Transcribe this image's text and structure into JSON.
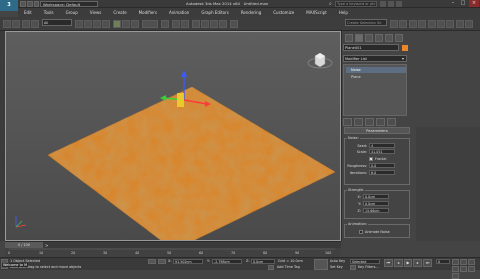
{
  "titlebar": {
    "logo": "3",
    "workspace": "Workspace: Default",
    "app_title": "Autodesk 3ds Max 2014 x64",
    "file_name": "Untitled.max",
    "search_placeholder": "Type a keyword or phrase"
  },
  "menu": [
    "Edit",
    "Tools",
    "Group",
    "Views",
    "Create",
    "Modifiers",
    "Animation",
    "Graph Editors",
    "Rendering",
    "Customize",
    "MAXScript",
    "Help"
  ],
  "toolbar": {
    "selection_filter": "All",
    "selection_set": "Create Selection Se"
  },
  "viewport": {
    "label": "[+] [Perspective] [Shaded]",
    "terrain_color": "#d8872e"
  },
  "command_panel": {
    "object_name": "Plane001",
    "object_color": "#e8882b",
    "modifier_list": "Modifier List",
    "stack": [
      "Noise",
      "Plane"
    ],
    "parameters_title": "Parameters",
    "noise_group": "Noise:",
    "seed_label": "Seed:",
    "seed_value": "4",
    "scale_label": "Scale:",
    "scale_value": "41.051",
    "fractal_label": "Fractal",
    "roughness_label": "Roughness:",
    "roughness_value": "0.0",
    "iterations_label": "Iterations:",
    "iterations_value": "6.0",
    "strength_group": "Strength:",
    "x_label": "X:",
    "x_value": "0.0cm",
    "y_label": "Y:",
    "y_value": "0.0cm",
    "z_label": "Z:",
    "z_value": "15.66cm",
    "animation_group": "Animation:",
    "animate_noise": "Animate Noise"
  },
  "timeline": {
    "frame_display": "0 / 100",
    "ticks": [
      "0",
      "10",
      "20",
      "30",
      "40",
      "50",
      "60",
      "70",
      "80",
      "90",
      "100"
    ]
  },
  "status": {
    "selected": "1 Object Selected",
    "prompt": "Click and drag to select and move objects",
    "x_label": "X:",
    "x_value": "91.502cm",
    "y_label": "Y:",
    "y_value": "-2.798cm",
    "z_label": "Z:",
    "z_value": "0.0cm",
    "grid": "Grid = 10.0cm",
    "add_time_tag": "Add Time Tag",
    "auto_key": "Auto Key",
    "selected_dropdown": "Selected",
    "set_key": "Set Key",
    "key_filters": "Key Filters...",
    "welcome": "Welcome to M"
  }
}
